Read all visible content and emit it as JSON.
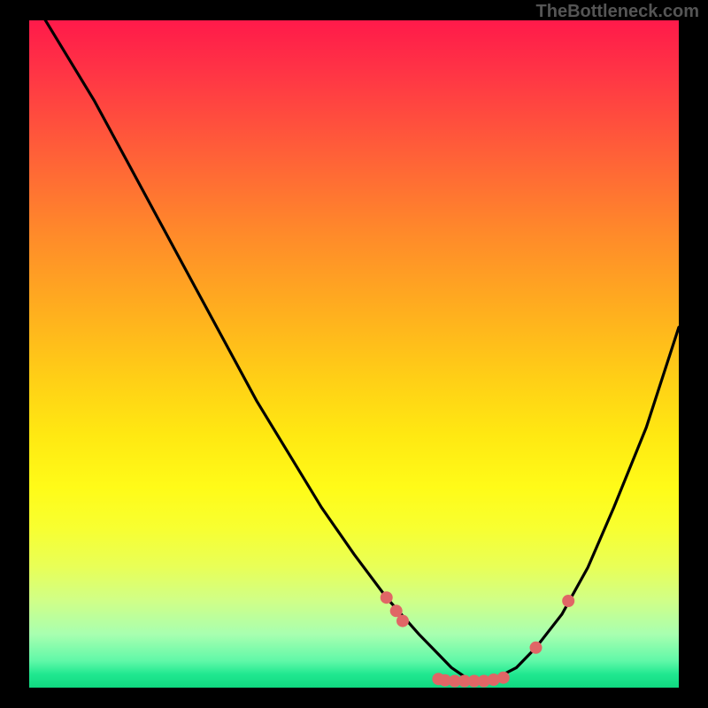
{
  "watermark": "TheBottleneck.com",
  "chart_data": {
    "type": "line",
    "title": "",
    "xlabel": "",
    "ylabel": "",
    "xlim": [
      0,
      100
    ],
    "ylim": [
      0,
      100
    ],
    "curve": {
      "description": "V-shaped bottleneck curve descending from top-left, reaching minimum near x≈68, then rising toward mid-right",
      "x": [
        0,
        5,
        10,
        15,
        20,
        25,
        30,
        35,
        40,
        45,
        50,
        55,
        60,
        63,
        65,
        68,
        70,
        72,
        75,
        78,
        82,
        86,
        90,
        95,
        100
      ],
      "y": [
        104,
        96,
        88,
        79,
        70,
        61,
        52,
        43,
        35,
        27,
        20,
        13.5,
        8,
        5,
        3,
        1,
        1,
        1.5,
        3,
        6,
        11,
        18,
        27,
        39,
        54
      ]
    },
    "markers": {
      "description": "salmon dot markers clustered around the valley",
      "points": [
        {
          "x": 55,
          "y": 13.5
        },
        {
          "x": 56.5,
          "y": 11.5
        },
        {
          "x": 57.5,
          "y": 10
        },
        {
          "x": 63,
          "y": 1.3
        },
        {
          "x": 64,
          "y": 1.1
        },
        {
          "x": 65.5,
          "y": 1
        },
        {
          "x": 67,
          "y": 1
        },
        {
          "x": 68.5,
          "y": 1
        },
        {
          "x": 70,
          "y": 1
        },
        {
          "x": 71.5,
          "y": 1.2
        },
        {
          "x": 73,
          "y": 1.5
        },
        {
          "x": 78,
          "y": 6
        },
        {
          "x": 83,
          "y": 13
        }
      ],
      "color": "#e06666",
      "radius_px": 7
    },
    "gradient_colors": {
      "top": "#ff1a4a",
      "mid": "#ffe812",
      "bottom": "#10d880"
    }
  }
}
